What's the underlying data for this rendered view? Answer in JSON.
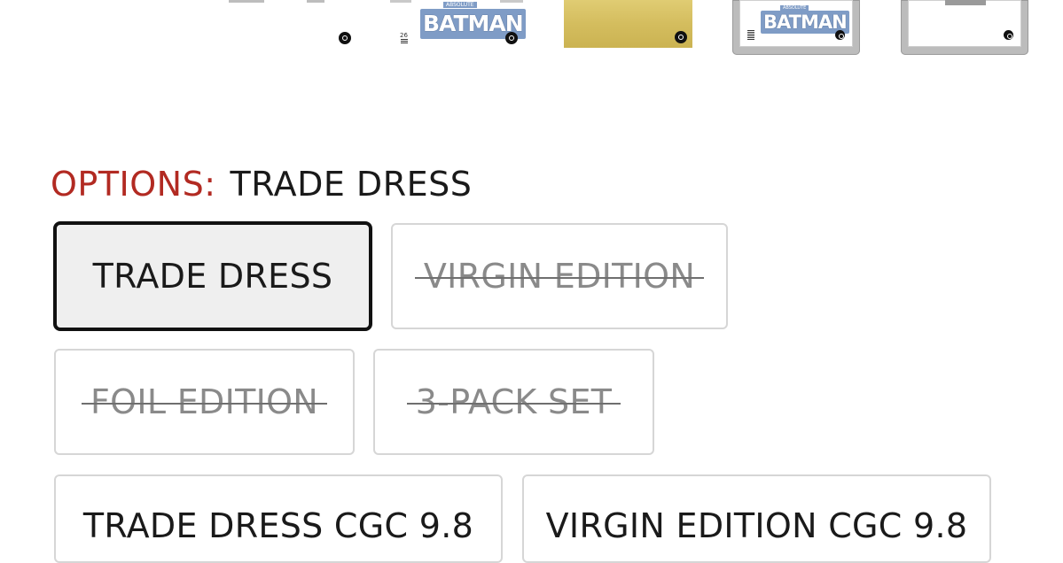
{
  "thumbnails": [
    {
      "name": "thumb-partial-cover"
    },
    {
      "name": "thumb-trade-dress",
      "title_word": "BATMAN",
      "prefix": "ABSOLUTE",
      "issue": "26"
    },
    {
      "name": "thumb-foil"
    },
    {
      "name": "thumb-cgc-trade-dress",
      "title_word": "BATMAN",
      "prefix": "ABSOLUTE"
    },
    {
      "name": "thumb-cgc-virgin"
    }
  ],
  "options": {
    "label": "OPTIONS:",
    "selected_value": "TRADE DRESS",
    "items": [
      {
        "label": "TRADE DRESS",
        "state": "selected"
      },
      {
        "label": "VIRGIN EDITION",
        "state": "unavailable"
      },
      {
        "label": "FOIL EDITION",
        "state": "unavailable"
      },
      {
        "label": "3-PACK SET",
        "state": "unavailable"
      },
      {
        "label": "TRADE DRESS CGC 9.8",
        "state": "available"
      },
      {
        "label": "VIRGIN EDITION CGC 9.8",
        "state": "available"
      }
    ]
  },
  "colors": {
    "options_label": "#b22a22",
    "selected_border": "#111111",
    "selected_bg": "#efefef",
    "border": "#d6d6d6",
    "unavailable_text": "#8a8a8a"
  }
}
